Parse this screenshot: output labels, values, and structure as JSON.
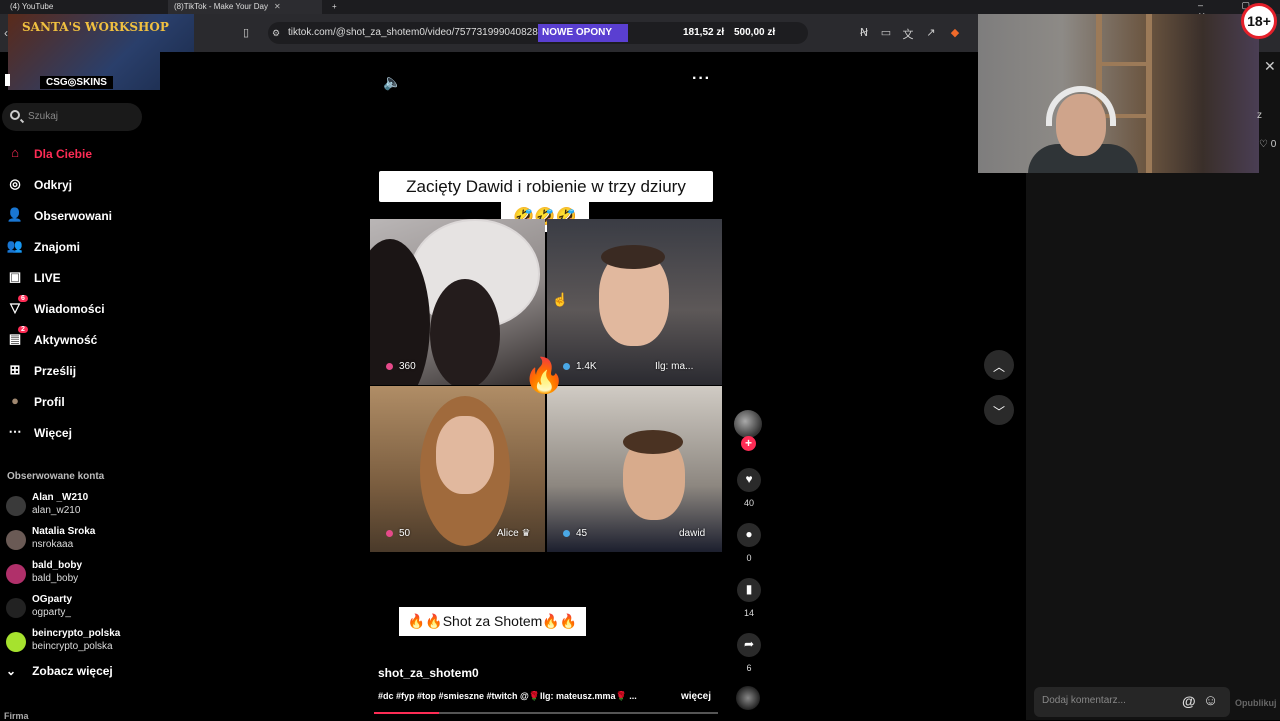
{
  "browser": {
    "tabs": [
      {
        "label": "(4) YouTube",
        "active": false
      },
      {
        "label": "(8)TikTok - Make Your Day",
        "active": true
      }
    ],
    "new_tab": "+",
    "url": "tiktok.com/@shot_za_shotem0/video/757731999040828546",
    "promo": "NOWE OPONY",
    "price1": "181,52 zł",
    "price2": "500,00 zł",
    "window_controls": "–  ▢  ✕"
  },
  "ad": {
    "title": "SANTA'S WORKSHOP",
    "subtitle": "CSG◎SKINS"
  },
  "sidebar": {
    "search_placeholder": "Szukaj",
    "nav": [
      {
        "label": "Dla Ciebie",
        "icon": "home-icon",
        "glyph": "⌂",
        "active": true
      },
      {
        "label": "Odkryj",
        "icon": "compass-icon",
        "glyph": "◎"
      },
      {
        "label": "Obserwowani",
        "icon": "following-icon",
        "glyph": "👤"
      },
      {
        "label": "Znajomi",
        "icon": "friends-icon",
        "glyph": "👥"
      },
      {
        "label": "LIVE",
        "icon": "live-icon",
        "glyph": "▣"
      },
      {
        "label": "Wiadomości",
        "icon": "messages-icon",
        "glyph": "▽",
        "badge": "6"
      },
      {
        "label": "Aktywność",
        "icon": "activity-icon",
        "glyph": "▤",
        "badge": "2"
      },
      {
        "label": "Prześlij",
        "icon": "upload-icon",
        "glyph": "⊞"
      },
      {
        "label": "Profil",
        "icon": "profile-icon",
        "glyph": "●"
      },
      {
        "label": "Więcej",
        "icon": "more-icon",
        "glyph": "⋯"
      }
    ],
    "followed_title": "Obserwowane konta",
    "accounts": [
      {
        "name": "Alan _W210",
        "user": "alan_w210",
        "color": "#3a3a3a"
      },
      {
        "name": "Natalia Sroka",
        "user": "nsrokaaa",
        "color": "#6a5a55"
      },
      {
        "name": "bald_boby",
        "user": "bald_boby",
        "color": "#b0306a"
      },
      {
        "name": "OGparty",
        "user": "ogparty_",
        "color": "#222222"
      },
      {
        "name": "beincrypto_polska",
        "user": "beincrypto_polska",
        "color": "#a6e22e"
      }
    ],
    "see_more": "Zobacz więcej",
    "see_more_icon": "⌄",
    "firma": "Firma"
  },
  "video": {
    "title": "Zacięty Dawid i robienie w trzy dziury",
    "title_emoji": "🤣🤣🤣",
    "cells": [
      {
        "count": "360",
        "dot": "#e64a8a",
        "tag": ""
      },
      {
        "count": "1.4K",
        "dot": "#4aa8e6",
        "tag": "Ilg: ma..."
      },
      {
        "count": "50",
        "dot": "#e64a8a",
        "tag": "Alice ♛"
      },
      {
        "count": "45",
        "dot": "#4aa8e6",
        "tag": "dawid"
      }
    ],
    "flame": "🔥",
    "caption": "🔥🔥Shot za Shotem🔥🔥",
    "author": "shot_za_shotem0",
    "hashtags": "#dc #fyp #top #smieszne #twitch @🌹Ilg: mateusz.mma🌹 ...",
    "more": "więcej",
    "progress": 0.19
  },
  "actions": {
    "likes": "40",
    "comments": "0",
    "saves": "14",
    "shares": "6"
  },
  "right_panel": {
    "age_badge": "18+",
    "side_letter": "z",
    "side_heart": "♡ 0",
    "comment_placeholder": "Dodaj komentarz...",
    "publish": "Opublikuj"
  }
}
